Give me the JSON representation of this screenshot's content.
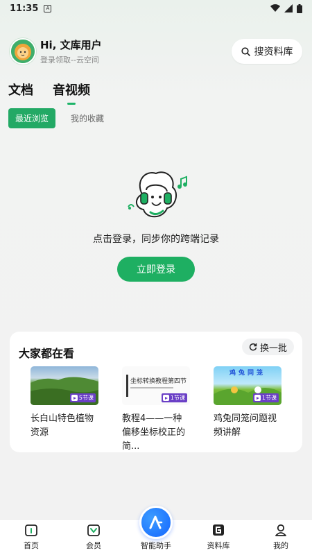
{
  "status_bar": {
    "time": "11:35"
  },
  "header": {
    "greeting": "Hi, 文库用户",
    "subtitle": "登录领取--云空间",
    "search_label": "搜资料库"
  },
  "main_tabs": [
    {
      "label": "文档",
      "active": false
    },
    {
      "label": "音视频",
      "active": true
    }
  ],
  "sub_tabs": [
    {
      "label": "最近浏览",
      "active": true
    },
    {
      "label": "我的收藏",
      "active": false
    }
  ],
  "empty_state": {
    "message": "点击登录，同步你的跨端记录",
    "login_button": "立即登录"
  },
  "popular": {
    "title": "大家都在看",
    "refresh_label": "换一批",
    "items": [
      {
        "title": "长白山特色植物资源",
        "badge": "5节课",
        "thumb_text": ""
      },
      {
        "title": "教程4——一种偏移坐标校正的简...",
        "badge": "1节课",
        "thumb_text": "坐标转换教程第四节"
      },
      {
        "title": "鸡兔同笼问题视频讲解",
        "badge": "1节课",
        "thumb_text": "鸡兔同笼"
      }
    ]
  },
  "bottom_nav": [
    {
      "label": "首页",
      "icon": "home-icon"
    },
    {
      "label": "会员",
      "icon": "vip-icon"
    },
    {
      "label": "智能助手",
      "icon": "assistant-icon"
    },
    {
      "label": "资料库",
      "icon": "library-icon"
    },
    {
      "label": "我的",
      "icon": "profile-icon"
    }
  ],
  "colors": {
    "accent_green": "#1eaf62",
    "badge_purple": "#6a3fc6",
    "assistant_blue": "#1466ff"
  }
}
